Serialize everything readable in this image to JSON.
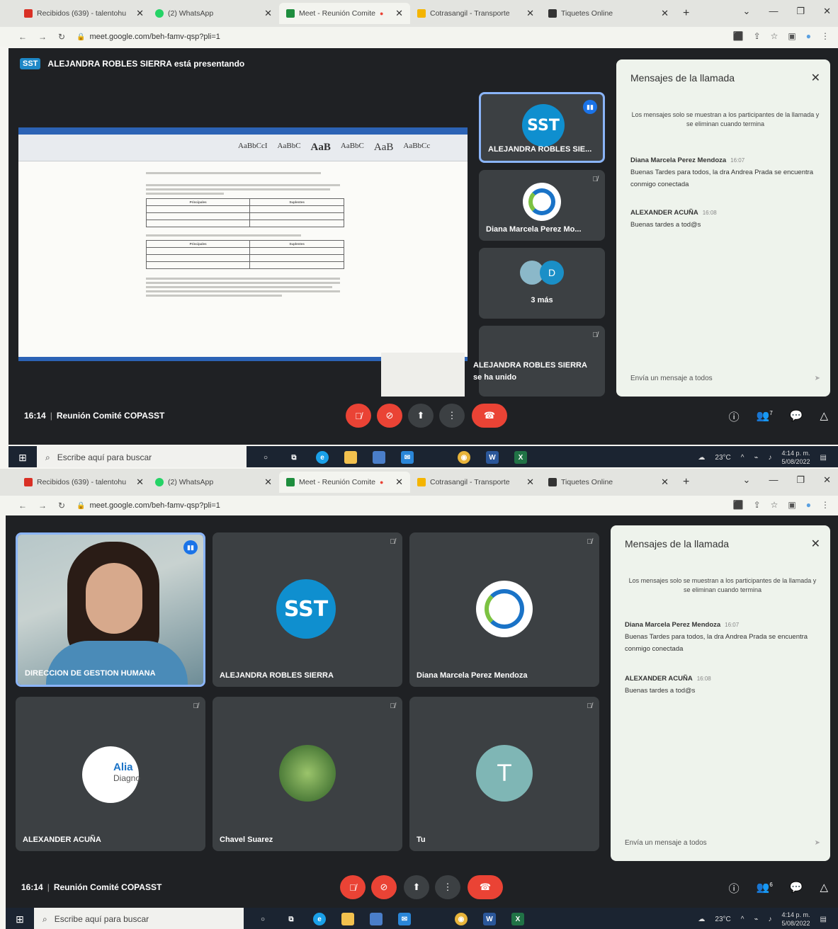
{
  "top": {
    "tabs": [
      {
        "label": "Recibidos (639) - talentohu",
        "color": "#d93025"
      },
      {
        "label": "(2) WhatsApp",
        "color": "#25d366"
      },
      {
        "label": "Meet - Reunión Comite",
        "color": "#1e8e3e"
      },
      {
        "label": "Cotrasangil - Transporte",
        "color": "#f4b400"
      },
      {
        "label": "Tiquetes Online",
        "color": "#333333"
      }
    ],
    "url": "meet.google.com/beh-famv-qsp?pli=1",
    "presenting": "ALEJANDRA ROBLES SIERRA está presentando",
    "presenting_badge": "SST",
    "side_tiles": {
      "presenter_logo": "SST",
      "presenter_name": "ALEJANDRA ROBLES SIE...",
      "diana_name": "Diana Marcela Perez Mo...",
      "more_initial": "D",
      "more_label": "3 más"
    },
    "toast": "ALEJANDRA ROBLES SIERRA se ha unido",
    "doc": {
      "ribbon_styles": [
        "AaBbCcI",
        "AaBbC",
        "AaB",
        "AaBbC",
        "AaB",
        "AaBbCc"
      ],
      "table1_headers": [
        "Principales",
        "Suplentes"
      ],
      "table2_headers": [
        "Principales",
        "Suplentes"
      ]
    },
    "meeting_time": "16:14",
    "meeting_name": "Reunión Comité COPASST",
    "participant_badge": "7",
    "taskbar_search": "Escribe aquí para buscar",
    "tray_temp": "23°C",
    "clock_time": "4:14 p. m.",
    "clock_date": "5/08/2022"
  },
  "bottom": {
    "tabs": [
      {
        "label": "Recibidos (639) - talentohu",
        "color": "#d93025"
      },
      {
        "label": "(2) WhatsApp",
        "color": "#25d366"
      },
      {
        "label": "Meet - Reunión Comite",
        "color": "#1e8e3e"
      },
      {
        "label": "Cotrasangil - Transporte",
        "color": "#f4b400"
      },
      {
        "label": "Tiquetes Online",
        "color": "#333333"
      }
    ],
    "url": "meet.google.com/beh-famv-qsp?pli=1",
    "tiles": {
      "t1": "DIRECCION DE GESTION HUMANA",
      "t2": "ALEJANDRA ROBLES SIERRA",
      "t2_logo": "SST",
      "t3": "Diana Marcela Perez Mendoza",
      "t4": "ALEXANDER ACUÑA",
      "t4_logo_text_1": "Alia",
      "t4_logo_text_2": "Diagno",
      "t5": "Chavel Suarez",
      "t6": "Tu",
      "t6_initial": "T"
    },
    "meeting_time": "16:14",
    "meeting_name": "Reunión Comité COPASST",
    "participant_badge": "6",
    "taskbar_search": "Escribe aquí para buscar",
    "tray_temp": "23°C",
    "clock_time": "4:14 p. m.",
    "clock_date": "5/08/2022"
  },
  "chat": {
    "title": "Mensajes de la llamada",
    "note": "Los mensajes solo se muestran a los participantes de la llamada y se eliminan cuando termina",
    "messages": [
      {
        "sender": "Diana Marcela Perez Mendoza",
        "time": "16:07",
        "text": "Buenas Tardes para todos, la dra Andrea Prada se encuentra conmigo conectada"
      },
      {
        "sender": "ALEXANDER ACUÑA",
        "time": "16:08",
        "text": "Buenas tardes a tod@s"
      }
    ],
    "input_placeholder": "Envía un mensaje a todos"
  }
}
